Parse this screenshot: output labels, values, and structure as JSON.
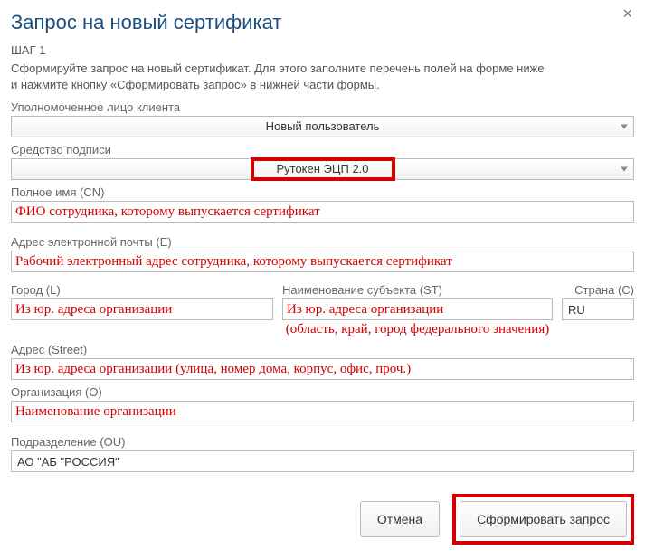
{
  "dialog": {
    "title": "Запрос на новый сертификат",
    "close": "×",
    "step": "ШАГ 1",
    "instr1": "Сформируйте запрос на новый сертификат. Для этого заполните перечень полей на форме ниже",
    "instr2": "и нажмите кнопку «Сформировать запрос» в нижней части формы."
  },
  "fields": {
    "auth_person": {
      "label": "Уполномоченное лицо клиента",
      "value": "Новый пользователь"
    },
    "sign_tool": {
      "label": "Средство подписи",
      "value": "Рутокен ЭЦП 2.0"
    },
    "cn": {
      "label": "Полное имя (CN)",
      "value": "ФИО сотрудника, которому выпускается сертификат"
    },
    "email": {
      "label": "Адрес электронной почты (E)",
      "value": "Рабочий электронный адрес сотрудника, которому выпускается сертификат"
    },
    "city": {
      "label": "Город (L)",
      "value": "Из юр. адреса организации"
    },
    "subject": {
      "label": "Наименование субъекта (ST)",
      "value": "Из юр. адреса организации",
      "annot": "(область, край, город федерального значения)"
    },
    "country": {
      "label": "Страна (C)",
      "value": "RU"
    },
    "street": {
      "label": "Адрес (Street)",
      "value": "Из юр. адреса организации (улица, номер дома, корпус, офис, проч.)"
    },
    "org": {
      "label": "Организация (O)",
      "value": "Наименование организации"
    },
    "ou": {
      "label": "Подразделение (OU)",
      "value": "АО \"АБ \"РОССИЯ\""
    }
  },
  "buttons": {
    "cancel": "Отмена",
    "submit": "Сформировать запрос"
  }
}
